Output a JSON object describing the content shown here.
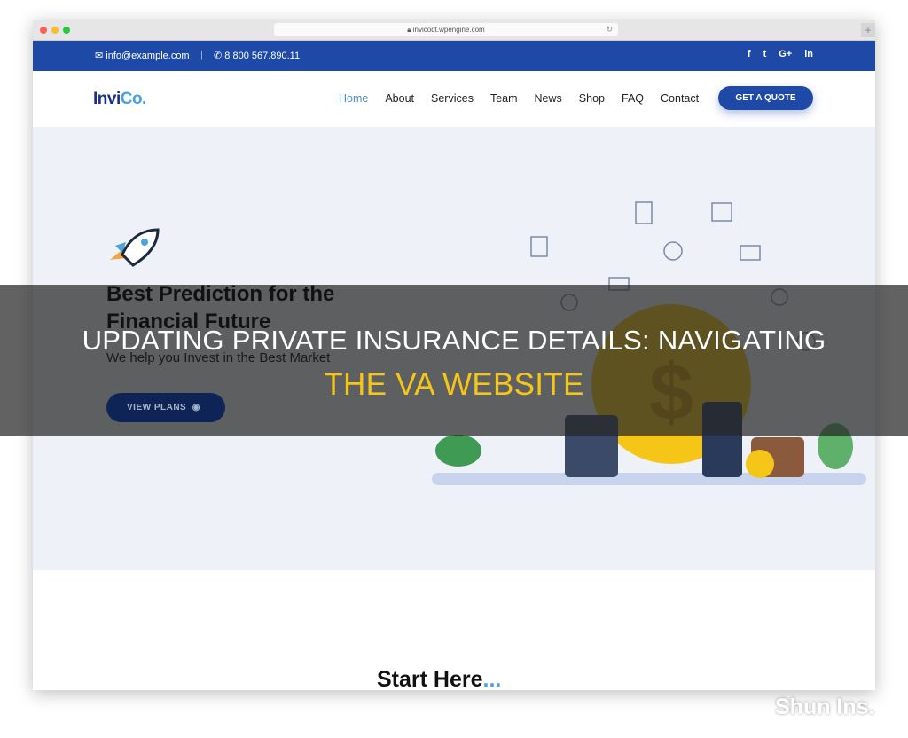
{
  "browser": {
    "url": "invicodt.wpengine.com"
  },
  "topbar": {
    "email": "info@example.com",
    "phone": "8 800 567.890.11",
    "social": [
      "f",
      "t",
      "G+",
      "in"
    ]
  },
  "nav": {
    "logo_main": "Invi",
    "logo_accent": "Co.",
    "items": [
      "Home",
      "About",
      "Services",
      "Team",
      "News",
      "Shop",
      "FAQ",
      "Contact"
    ],
    "active": "Home",
    "cta": "GET A QUOTE"
  },
  "hero": {
    "title_line1": "Best Prediction for the",
    "title_line2": "Financial Future",
    "subtitle": "We help you Invest in the Best Market",
    "button": "VIEW PLANS"
  },
  "section": {
    "title": "Start Here",
    "accent": "..."
  },
  "overlay": {
    "line1": "UPDATING PRIVATE INSURANCE DETAILS: NAVIGATING",
    "line2": "THE VA WEBSITE"
  },
  "watermark": "Shun Ins.",
  "colors": {
    "brand": "#1f49a6",
    "accent": "#4aa3df",
    "title_highlight": "#f5c518"
  }
}
